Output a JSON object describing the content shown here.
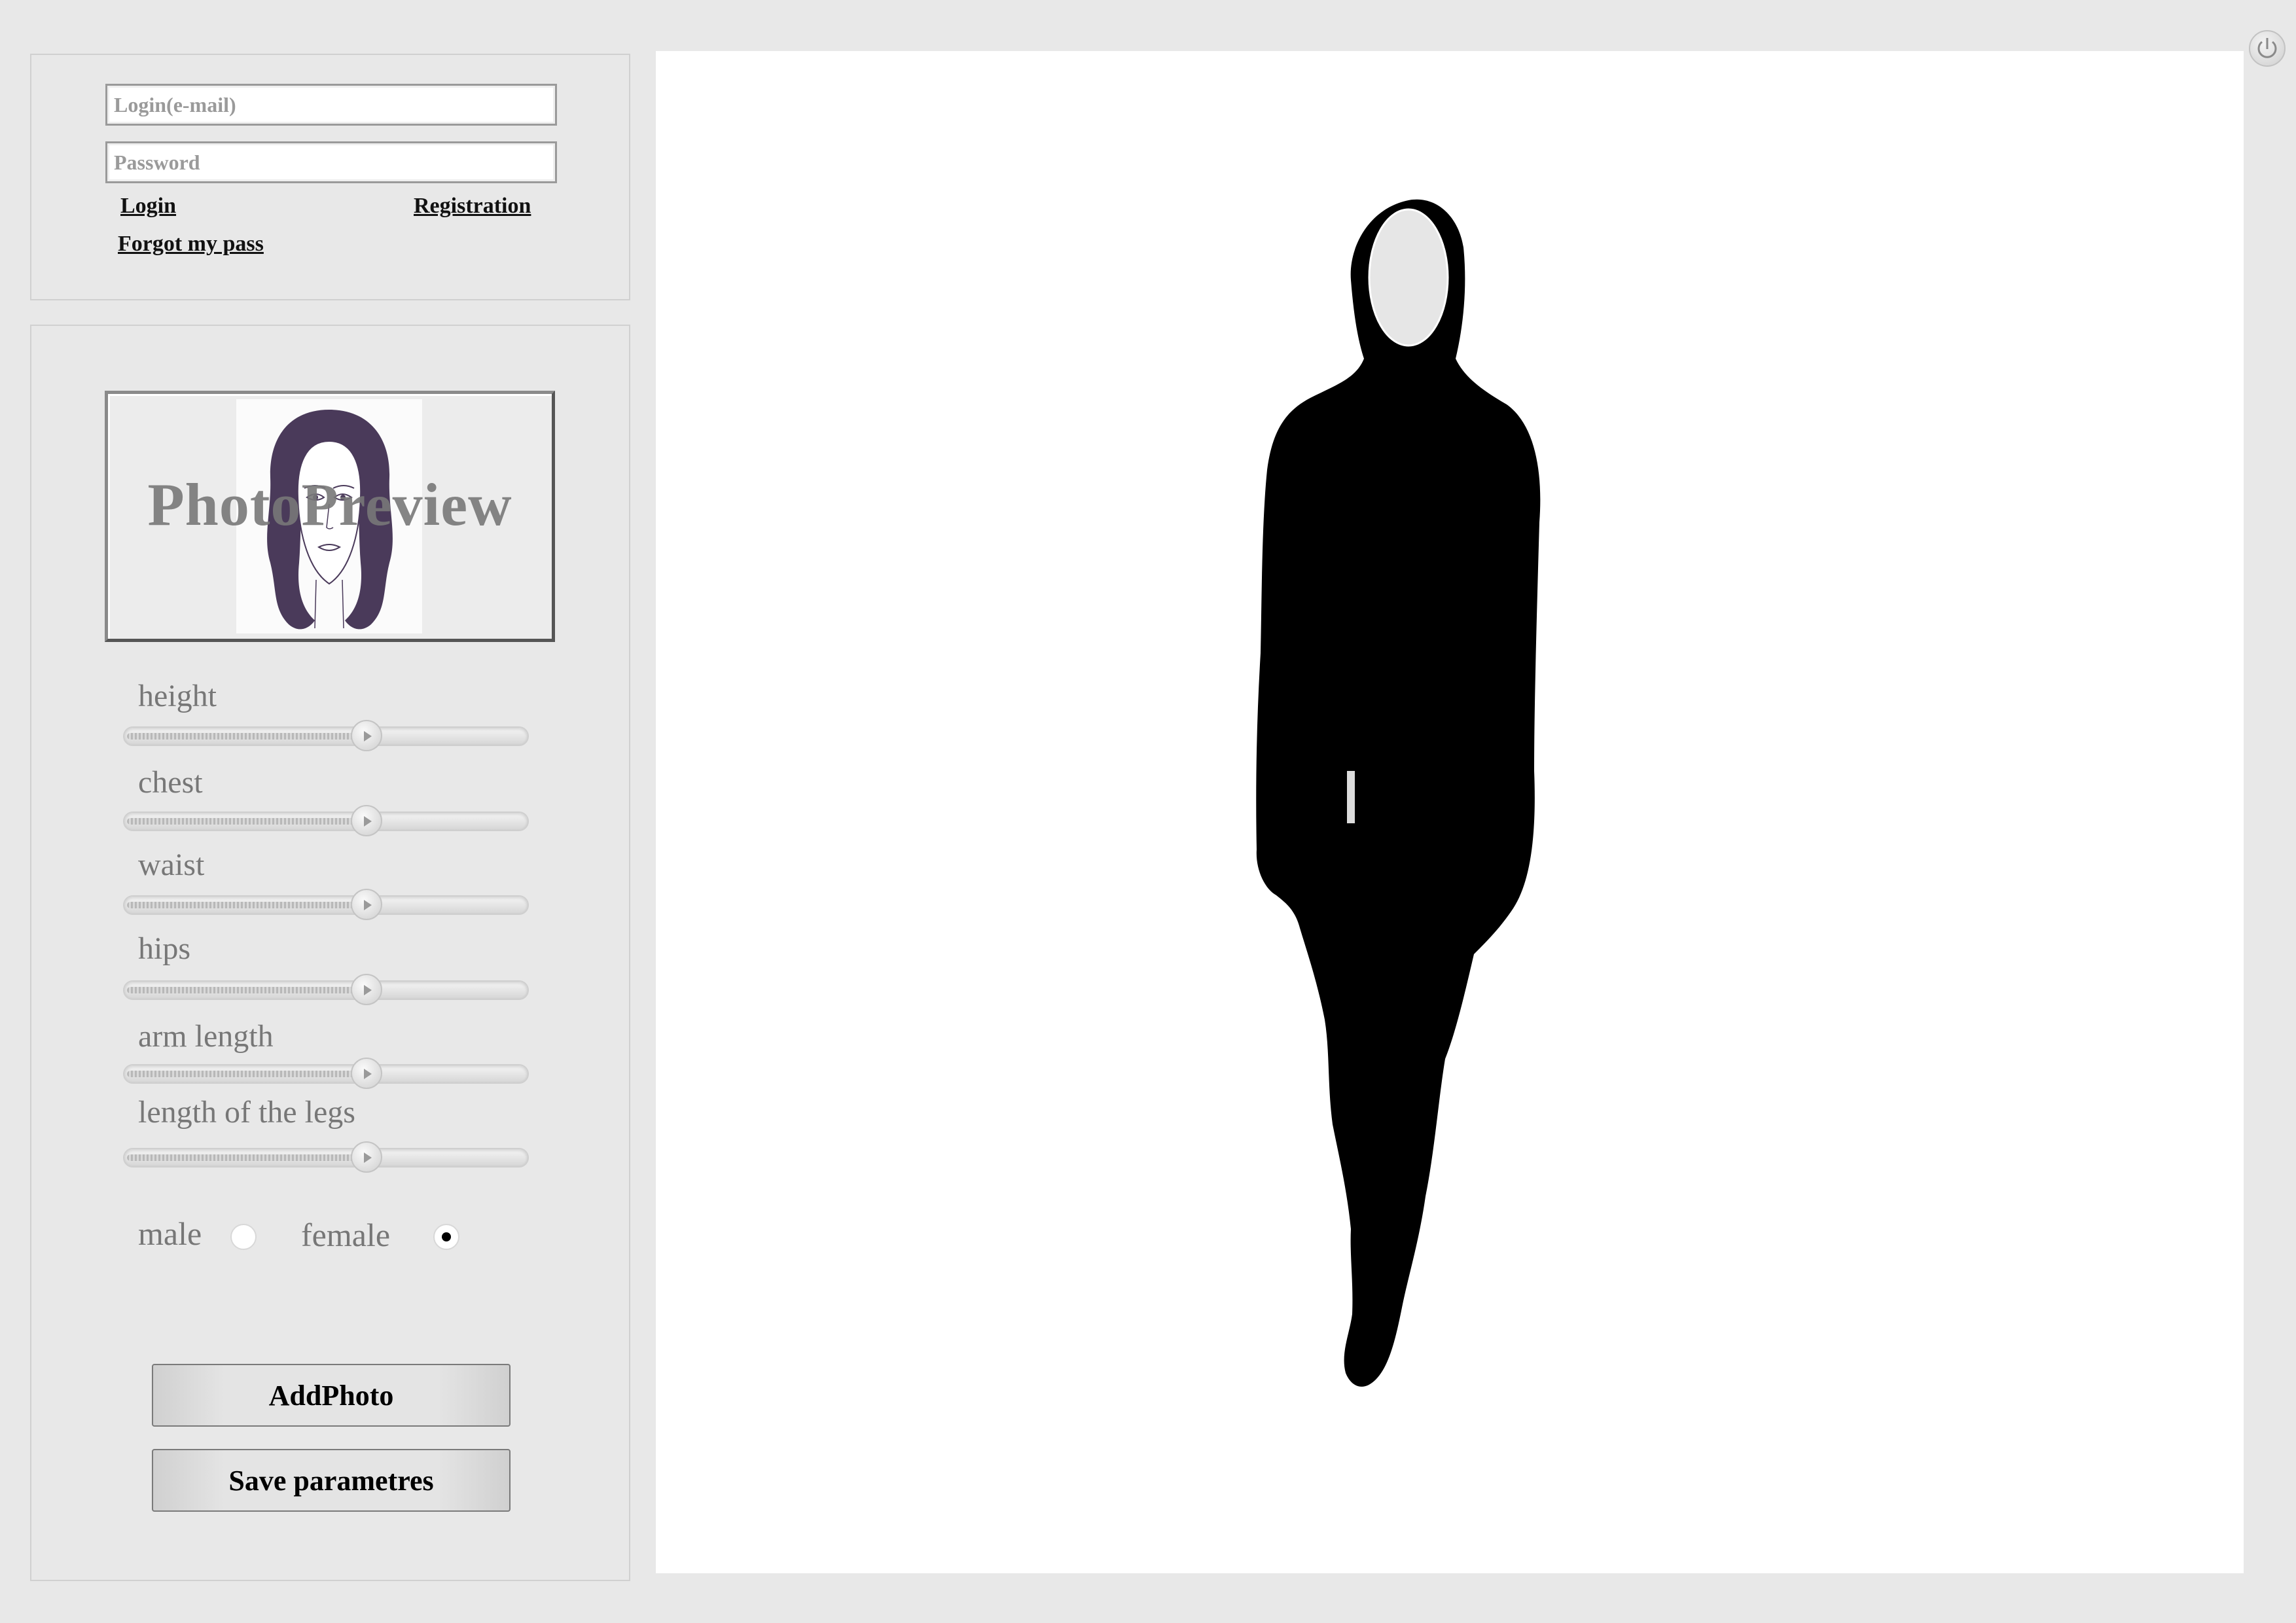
{
  "login": {
    "email_placeholder": "Login(e-mail)",
    "password_placeholder": "Password",
    "login_label": "Login",
    "registration_label": "Registration",
    "forgot_label": "Forgot my pass"
  },
  "preview": {
    "text": "PhotoPreview"
  },
  "sliders": [
    {
      "label": "height",
      "value_percent": 60
    },
    {
      "label": "chest",
      "value_percent": 60
    },
    {
      "label": "waist",
      "value_percent": 60
    },
    {
      "label": "hips",
      "value_percent": 60
    },
    {
      "label": "arm length",
      "value_percent": 60
    },
    {
      "label": "length of the legs",
      "value_percent": 60
    }
  ],
  "gender": {
    "male_label": "male",
    "female_label": "female",
    "selected": "female"
  },
  "buttons": {
    "add_photo": "AddPhoto",
    "save_parameters": "Save parametres"
  },
  "icons": {
    "power": "power-icon",
    "slider_knob": "play-arrow-icon"
  },
  "colors": {
    "background": "#e8e8e8",
    "canvas": "#ffffff",
    "silhouette": "#000000"
  }
}
